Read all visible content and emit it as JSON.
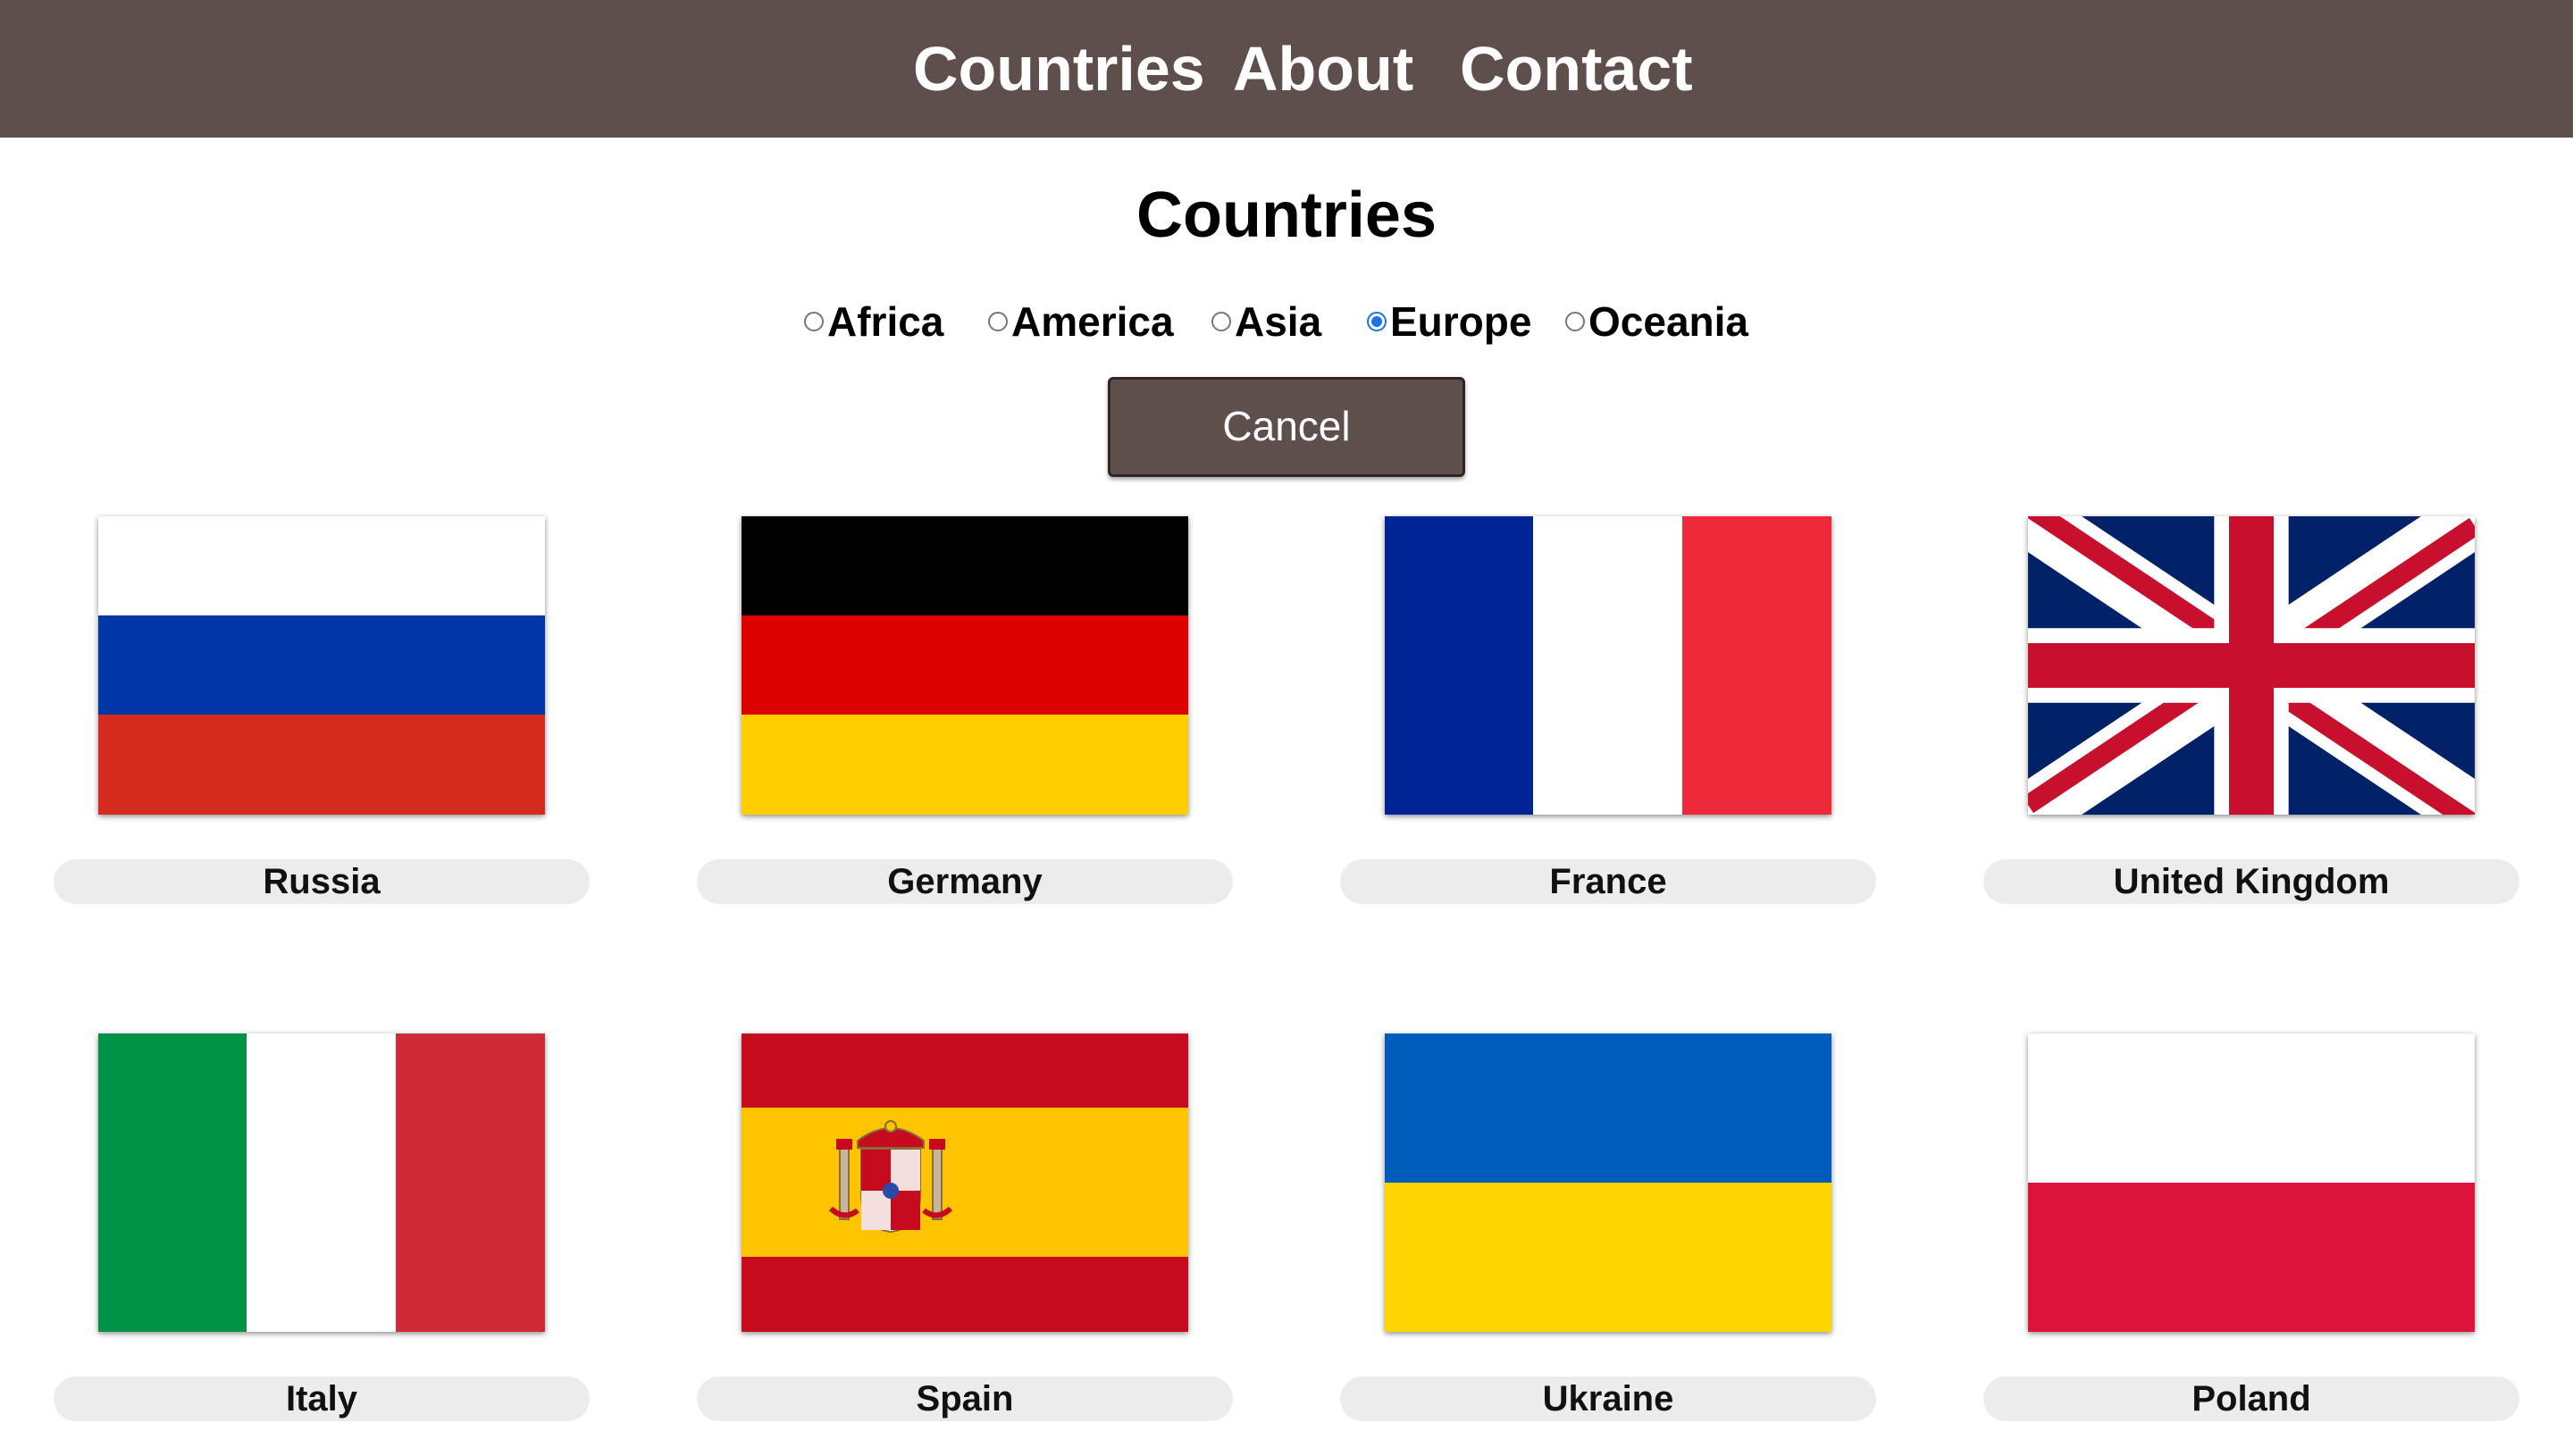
{
  "nav": {
    "items": [
      {
        "label": "Countries"
      },
      {
        "label": "About"
      },
      {
        "label": "Contact"
      }
    ],
    "background_color": "#5f4f4c"
  },
  "page": {
    "title": "Countries"
  },
  "regions": {
    "options": [
      {
        "label": "Africa",
        "checked": false
      },
      {
        "label": "America",
        "checked": false
      },
      {
        "label": "Asia",
        "checked": false
      },
      {
        "label": "Europe",
        "checked": true
      },
      {
        "label": "Oceania",
        "checked": false
      }
    ],
    "selected": "Europe"
  },
  "actions": {
    "cancel_label": "Cancel"
  },
  "countries": [
    {
      "name": "Russia",
      "flag_icon": "russia-flag-icon"
    },
    {
      "name": "Germany",
      "flag_icon": "germany-flag-icon"
    },
    {
      "name": "France",
      "flag_icon": "france-flag-icon"
    },
    {
      "name": "United Kingdom",
      "flag_icon": "united-kingdom-flag-icon"
    },
    {
      "name": "Italy",
      "flag_icon": "italy-flag-icon"
    },
    {
      "name": "Spain",
      "flag_icon": "spain-flag-icon"
    },
    {
      "name": "Ukraine",
      "flag_icon": "ukraine-flag-icon"
    },
    {
      "name": "Poland",
      "flag_icon": "poland-flag-icon"
    }
  ]
}
